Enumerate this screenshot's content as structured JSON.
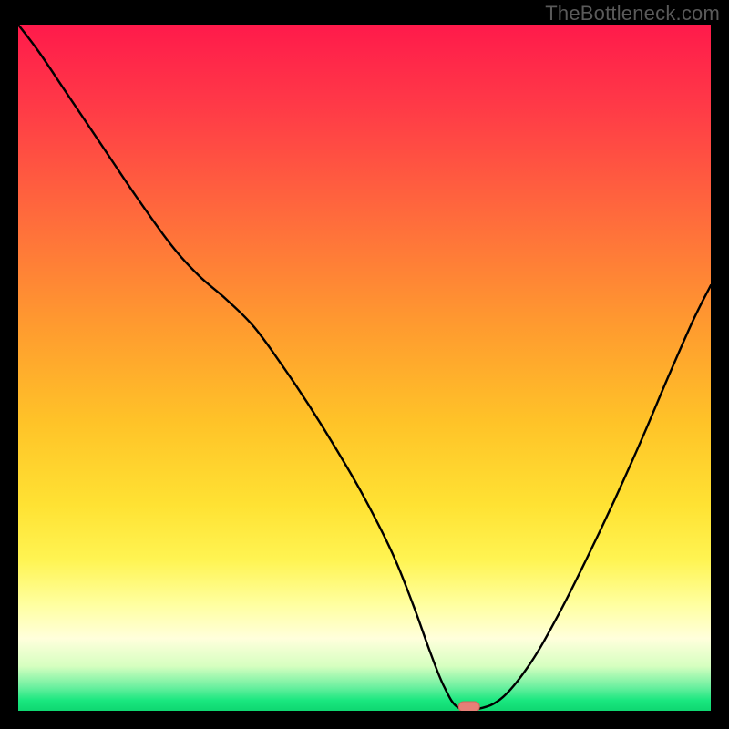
{
  "watermark": "TheBottleneck.com",
  "colors": {
    "background": "#000000",
    "watermark_text": "#5a5a5a",
    "curve": "#000000",
    "marker_fill": "#e77f77",
    "marker_stroke": "#d3645d",
    "gradient_stops": [
      {
        "offset": 0.0,
        "color": "#ff1a4b"
      },
      {
        "offset": 0.12,
        "color": "#ff3a47"
      },
      {
        "offset": 0.28,
        "color": "#ff6b3c"
      },
      {
        "offset": 0.44,
        "color": "#ff9b2f"
      },
      {
        "offset": 0.58,
        "color": "#ffc328"
      },
      {
        "offset": 0.7,
        "color": "#ffe233"
      },
      {
        "offset": 0.78,
        "color": "#fff452"
      },
      {
        "offset": 0.845,
        "color": "#ffffa0"
      },
      {
        "offset": 0.895,
        "color": "#ffffdc"
      },
      {
        "offset": 0.935,
        "color": "#d6ffc0"
      },
      {
        "offset": 0.965,
        "color": "#6df0a0"
      },
      {
        "offset": 0.985,
        "color": "#1ae77f"
      },
      {
        "offset": 1.0,
        "color": "#0fd771"
      }
    ]
  },
  "chart_data": {
    "type": "line",
    "title": "",
    "xlabel": "",
    "ylabel": "",
    "xlim": [
      0,
      100
    ],
    "ylim": [
      0,
      100
    ],
    "series": [
      {
        "name": "bottleneck-curve",
        "x": [
          0.0,
          3.0,
          7.0,
          12.0,
          17.0,
          22.0,
          26.0,
          30.0,
          34.0,
          38.0,
          42.0,
          46.0,
          50.0,
          54.0,
          57.0,
          59.5,
          61.5,
          63.5,
          66.5,
          70.0,
          74.0,
          78.0,
          82.0,
          86.0,
          90.0,
          94.0,
          97.5,
          100.0
        ],
        "y": [
          100.0,
          96.0,
          90.0,
          82.5,
          75.0,
          68.0,
          63.5,
          60.0,
          56.0,
          50.5,
          44.5,
          38.0,
          31.0,
          23.0,
          15.5,
          8.5,
          3.5,
          0.5,
          0.3,
          2.0,
          7.0,
          14.0,
          22.0,
          30.5,
          39.5,
          49.0,
          57.0,
          62.0
        ]
      }
    ],
    "marker": {
      "x": 65.1,
      "y": 0.6
    }
  }
}
